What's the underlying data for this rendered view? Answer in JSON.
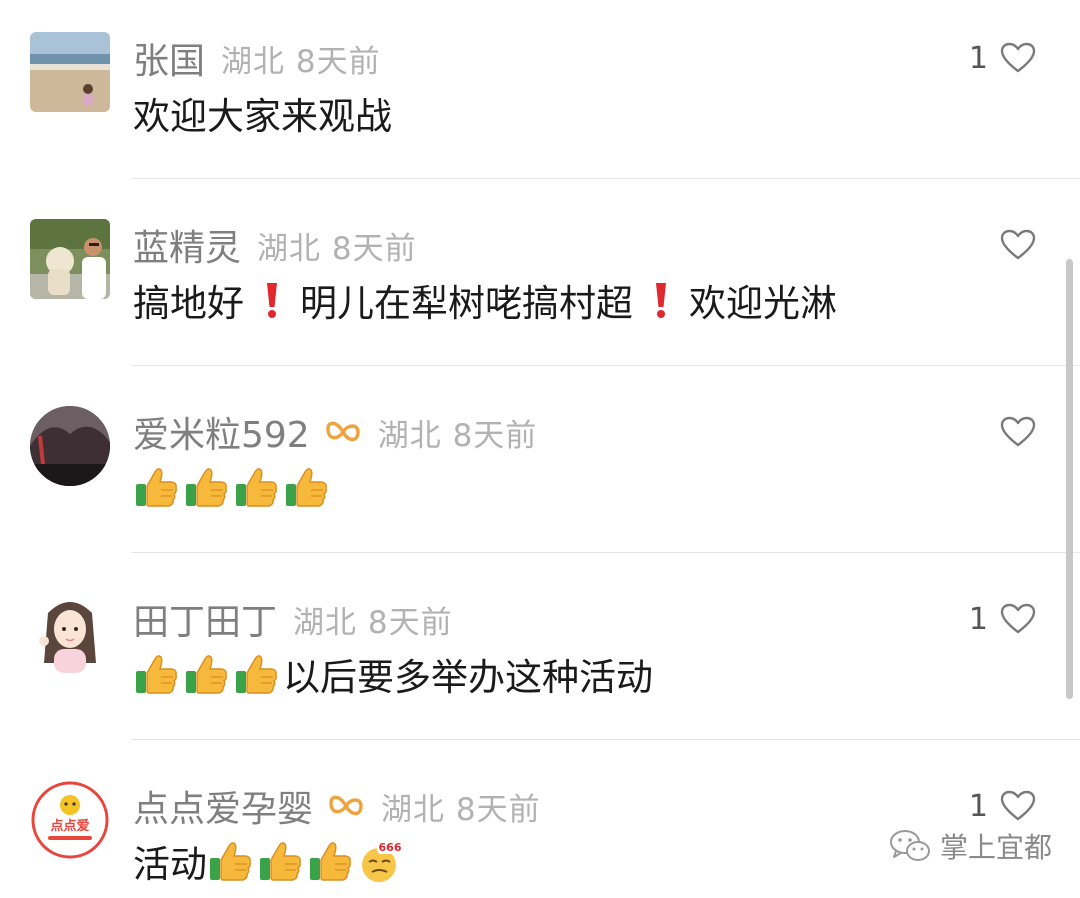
{
  "comments": [
    {
      "name": "张国",
      "meta": "湖北 8天前",
      "text_parts": [
        "欢迎大家来观战"
      ],
      "likes": "1",
      "avatar": "beach-child-photo",
      "has_badge": false
    },
    {
      "name": "蓝精灵",
      "meta": "湖北 8天前",
      "text_parts": [
        "搞地好",
        "明儿在犁树咾搞村超",
        "欢迎光淋"
      ],
      "likes": "",
      "avatar": "man-with-dog-photo",
      "has_badge": false
    },
    {
      "name": "爱米粒592",
      "meta": "湖北 8天前",
      "text_parts": [],
      "emoji_count": 4,
      "likes": "",
      "avatar": "sunset-landscape-photo",
      "has_badge": true
    },
    {
      "name": "田丁田丁",
      "meta": "湖北 8天前",
      "text_parts": [
        "以后要多举办这种活动"
      ],
      "emoji_count": 3,
      "likes": "1",
      "avatar": "cartoon-girl-illustration",
      "has_badge": false
    },
    {
      "name": "点点爱孕婴",
      "meta": "湖北 8天前",
      "text_parts": [
        "活动"
      ],
      "emoji_count": 3,
      "likes": "1",
      "avatar": "dian-dian-logo",
      "avatar_text": "点点爱",
      "has_badge": true
    }
  ],
  "icons": {
    "like": "heart-outline-icon",
    "badge": "infinity-badge-icon",
    "thumbs": "thumbs-up-emoji",
    "exclaim": "red-exclamation-emoji",
    "emoji_666": "666-emoji",
    "watermark": "wechat-icon"
  },
  "emoji_666_label": "666",
  "watermark": {
    "label": "掌上宜都"
  },
  "colors": {
    "name": "#7f7f7f",
    "meta": "#b2b2b2",
    "text": "#1a1a1a",
    "badge": "#f0a23c",
    "exclaim": "#e0282e"
  }
}
